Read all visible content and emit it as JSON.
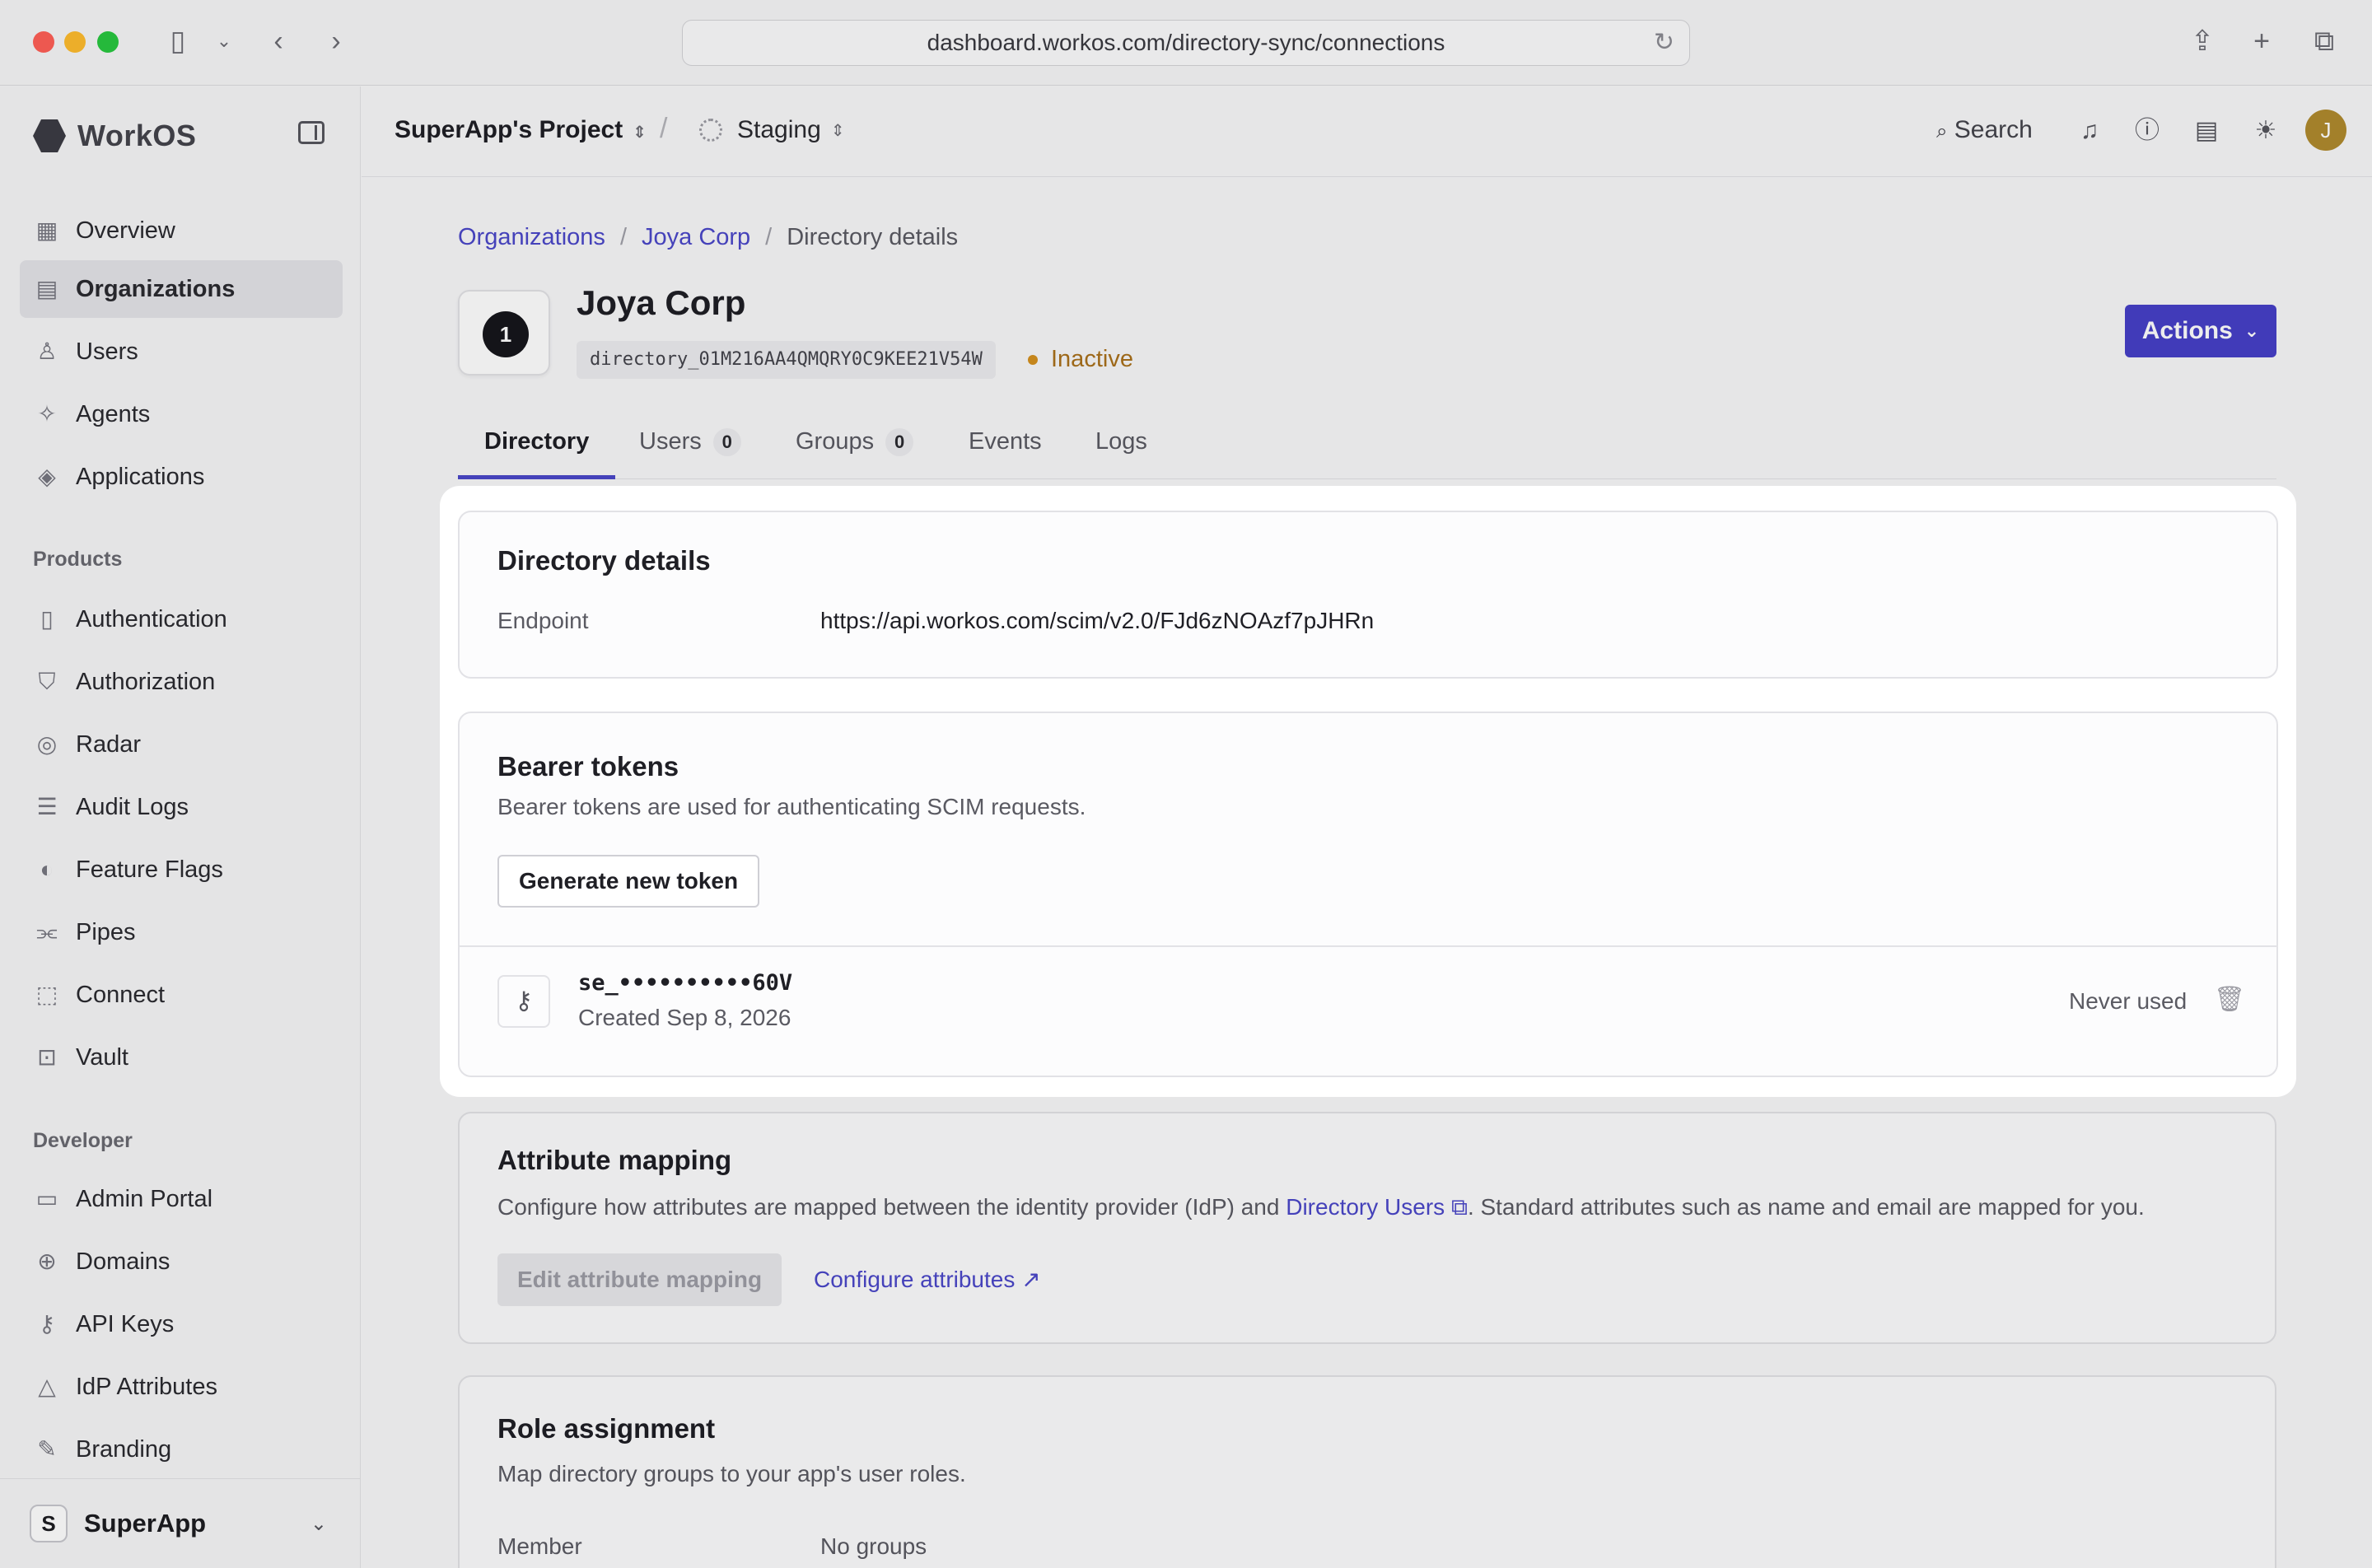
{
  "browser": {
    "url": "dashboard.workos.com/directory-sync/connections"
  },
  "sidebar": {
    "brand": "WorkOS",
    "items": [
      {
        "label": "Overview",
        "icon": "grid-icon"
      },
      {
        "label": "Organizations",
        "icon": "building-icon"
      },
      {
        "label": "Users",
        "icon": "user-icon"
      },
      {
        "label": "Agents",
        "icon": "sparkle-icon"
      },
      {
        "label": "Applications",
        "icon": "layers-icon"
      }
    ],
    "products_label": "Products",
    "products": [
      {
        "label": "Authentication",
        "icon": "auth-icon"
      },
      {
        "label": "Authorization",
        "icon": "shield-icon"
      },
      {
        "label": "Radar",
        "icon": "radar-icon"
      },
      {
        "label": "Audit Logs",
        "icon": "logs-icon"
      },
      {
        "label": "Feature Flags",
        "icon": "toggle-icon"
      },
      {
        "label": "Pipes",
        "icon": "pipes-icon"
      },
      {
        "label": "Connect",
        "icon": "connect-icon"
      },
      {
        "label": "Vault",
        "icon": "vault-icon"
      }
    ],
    "developer_label": "Developer",
    "developer": [
      {
        "label": "Admin Portal",
        "icon": "portal-icon"
      },
      {
        "label": "Domains",
        "icon": "globe-icon"
      },
      {
        "label": "API Keys",
        "icon": "key-icon"
      },
      {
        "label": "IdP Attributes",
        "icon": "shapes-icon"
      },
      {
        "label": "Branding",
        "icon": "brush-icon"
      }
    ],
    "workspace": {
      "initial": "S",
      "name": "SuperApp"
    }
  },
  "topbar": {
    "project": "SuperApp's Project",
    "environment": "Staging",
    "search": "Search",
    "avatar_initial": "J"
  },
  "breadcrumb": {
    "items": [
      "Organizations",
      "Joya Corp"
    ],
    "current": "Directory details"
  },
  "header": {
    "logo_glyph": "1",
    "title": "Joya Corp",
    "directory_id": "directory_01M216AA4QMQRY0C9KEE21V54W",
    "status": "Inactive",
    "actions_label": "Actions"
  },
  "tabs": [
    {
      "label": "Directory"
    },
    {
      "label": "Users",
      "count": "0"
    },
    {
      "label": "Groups",
      "count": "0"
    },
    {
      "label": "Events"
    },
    {
      "label": "Logs"
    }
  ],
  "directory_details": {
    "title": "Directory details",
    "endpoint_label": "Endpoint",
    "endpoint_value": "https://api.workos.com/scim/v2.0/FJd6zNOAzf7pJHRn"
  },
  "bearer_tokens": {
    "title": "Bearer tokens",
    "description": "Bearer tokens are used for authenticating SCIM requests.",
    "generate_label": "Generate new token",
    "token": {
      "masked": "se_••••••••••60V",
      "created": "Created Sep 8, 2026",
      "usage": "Never used"
    }
  },
  "attribute_mapping": {
    "title": "Attribute mapping",
    "desc_before": "Configure how attributes are mapped between the identity provider (IdP) and ",
    "desc_link": "Directory Users",
    "desc_after": ". Standard attributes such as name and email are mapped for you.",
    "edit_label": "Edit attribute mapping",
    "configure_label": "Configure attributes"
  },
  "role_assignment": {
    "title": "Role assignment",
    "description": "Map directory groups to your app's user roles.",
    "member_label": "Member",
    "member_value": "No groups"
  }
}
